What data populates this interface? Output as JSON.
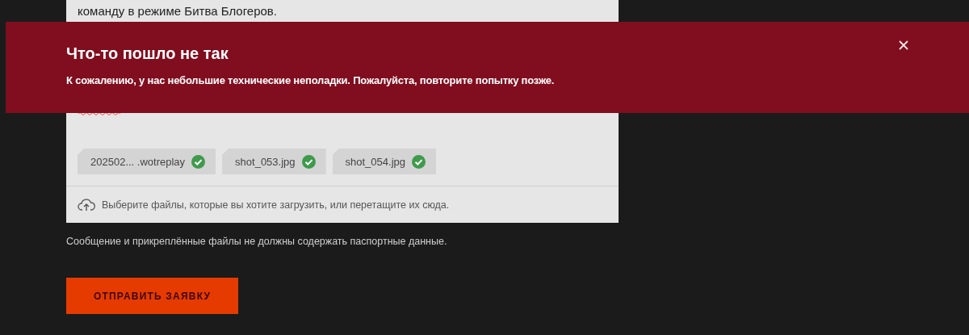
{
  "form": {
    "message_tail": "команду в режиме Битва Блогеров.",
    "files": [
      {
        "name": "202502... .wotreplay",
        "uploaded": true
      },
      {
        "name": "shot_053.jpg",
        "uploaded": true
      },
      {
        "name": "shot_054.jpg",
        "uploaded": true
      }
    ],
    "upload_hint": "Выберите файлы, которые вы хотите загрузить, или перетащите их сюда."
  },
  "notice": "Сообщение и прикреплённые файлы не должны содержать паспортные данные.",
  "submit_button": "ОТПРАВИТЬ ЗАЯВКУ",
  "error_banner": {
    "title": "Что-то пошло не так",
    "message": "К сожалению, у нас небольшие технические неполадки. Пожалуйста, повторите попытку позже."
  }
}
